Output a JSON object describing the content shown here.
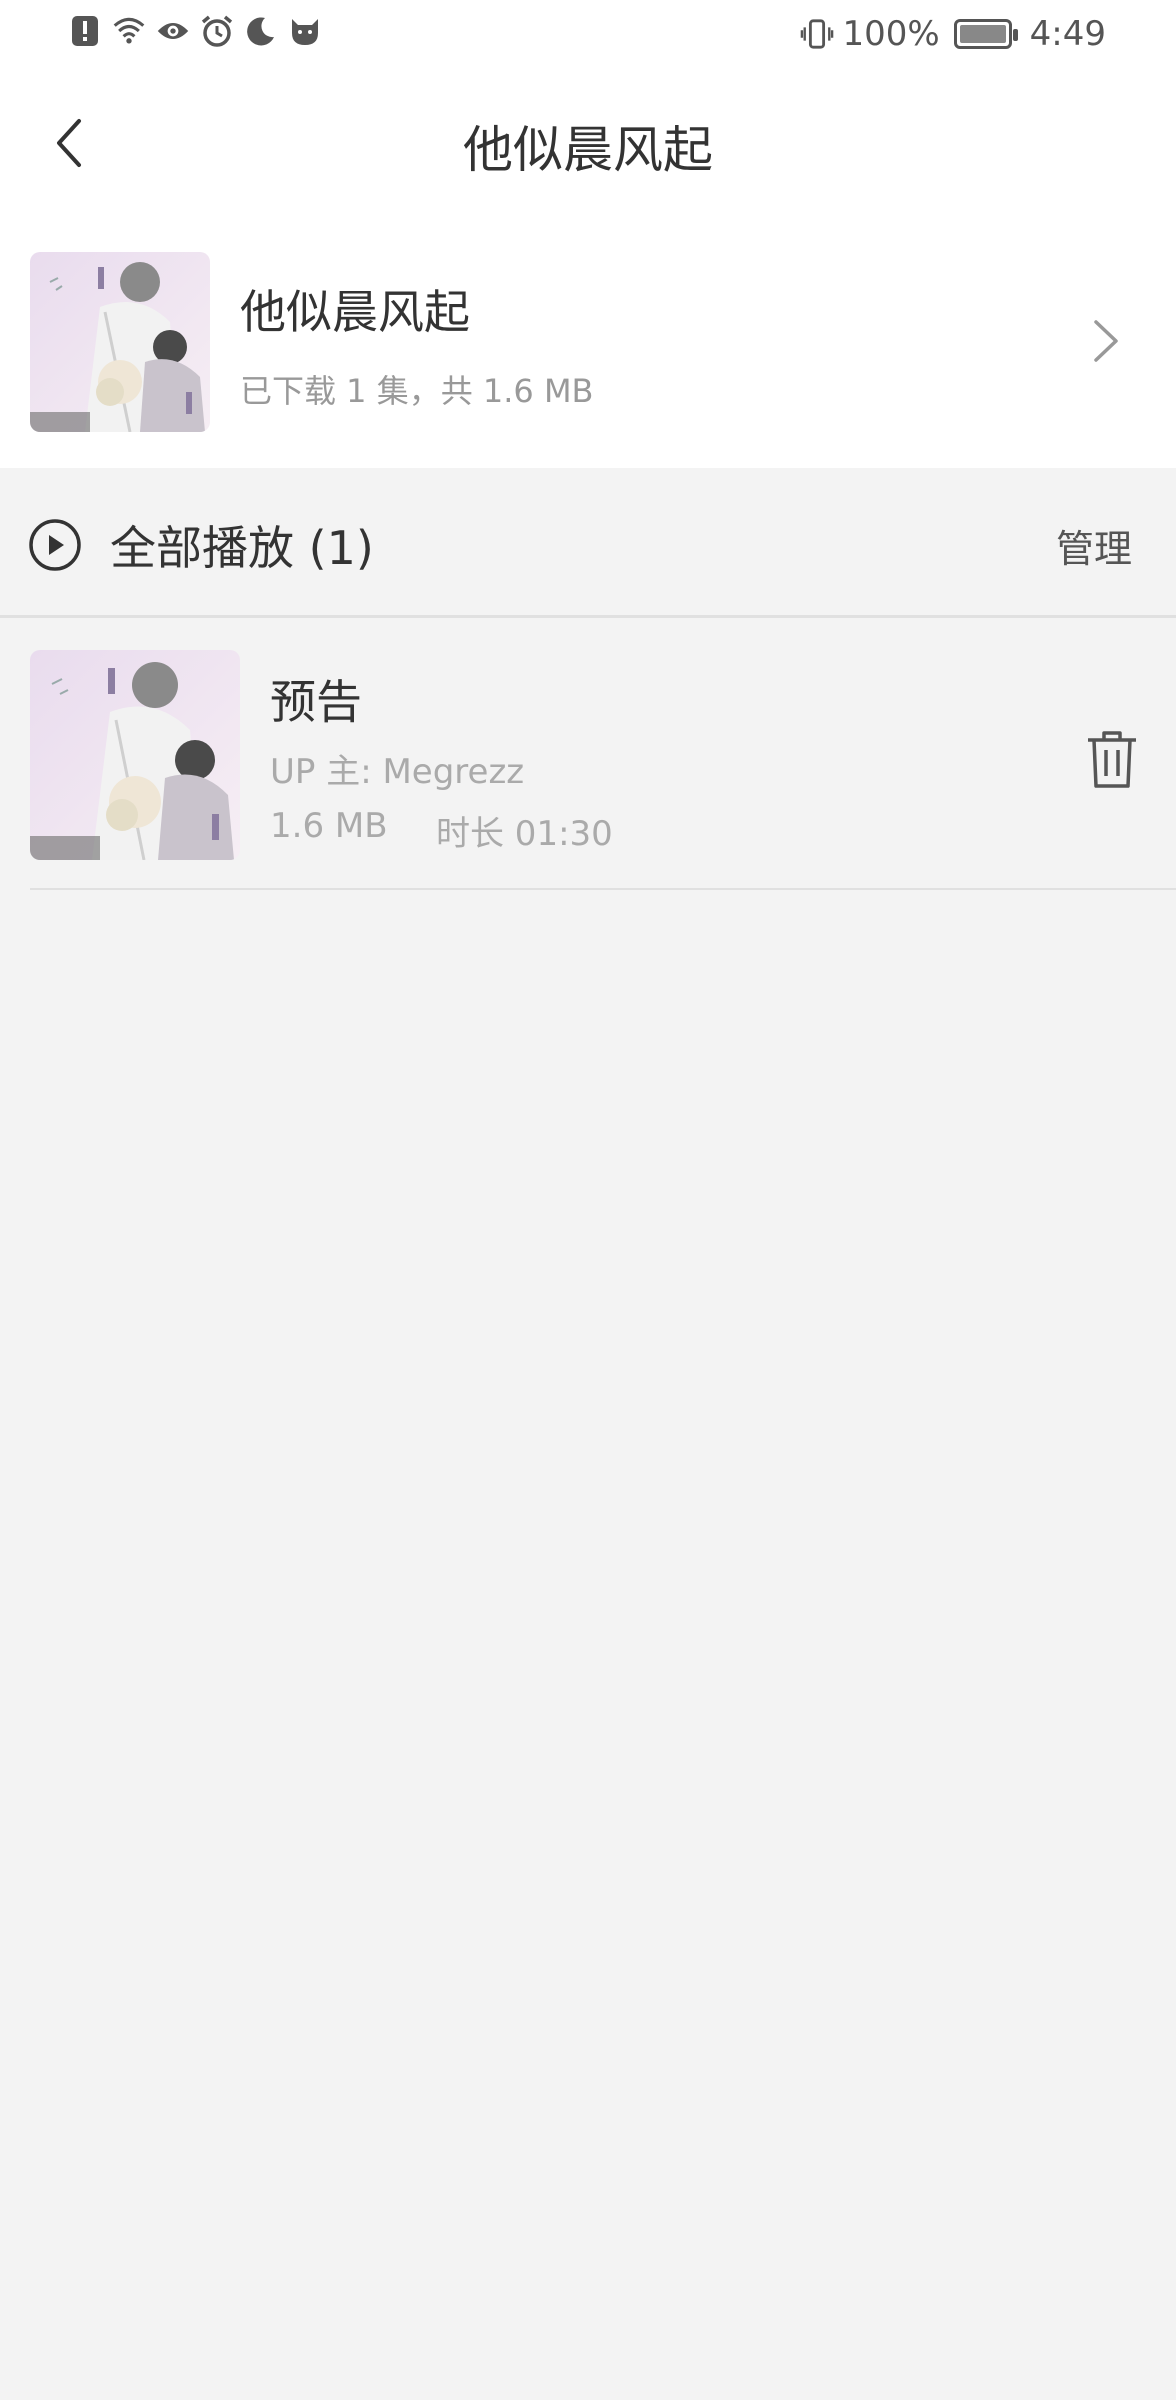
{
  "status_bar": {
    "left_icons": [
      "alert-icon",
      "wifi-icon",
      "eye-icon",
      "alarm-icon",
      "moon-icon",
      "cat-icon"
    ],
    "vibrate_icon": "vibrate-icon",
    "battery_percent": "100%",
    "battery_level": 1.0,
    "time": "4:49"
  },
  "nav": {
    "title": "他似晨风起",
    "back_icon": "back-arrow-icon"
  },
  "album": {
    "title": "他似晨风起",
    "subtitle": "已下载 1 集，共 1.6 MB",
    "chevron_icon": "chevron-right-icon"
  },
  "play_all": {
    "label": "全部播放 (1)",
    "manage_label": "管理",
    "icon": "play-circle-icon"
  },
  "episodes": [
    {
      "title": "预告",
      "uploader": "UP 主: Megrezz",
      "size": "1.6 MB",
      "duration": "时长 01:30",
      "delete_icon": "trash-icon"
    }
  ],
  "colors": {
    "background": "#f3f3f3",
    "surface": "#ffffff",
    "primary_text": "#333333",
    "secondary_text": "#999999"
  }
}
